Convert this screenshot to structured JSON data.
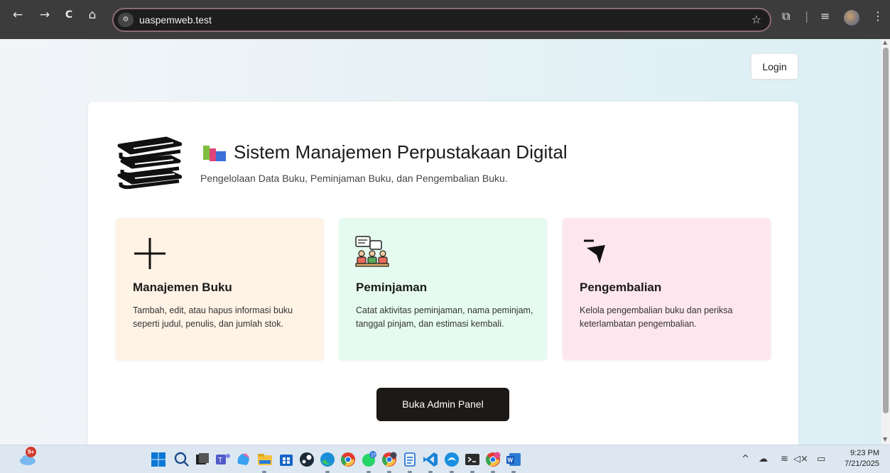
{
  "browser": {
    "url": "uaspemweb.test",
    "back_icon": "←",
    "forward_icon": "→",
    "reload_icon": "C",
    "home_icon": "⌂",
    "site_info_icon": "⚙",
    "star_icon": "☆",
    "extensions_icon": "⧉",
    "separator": "|",
    "reading_list_icon": "≡",
    "menu_icon": "⋮"
  },
  "header": {
    "login_label": "Login"
  },
  "hero": {
    "title": "Sistem Manajemen Perpustakaan Digital",
    "subtitle": "Pengelolaan Data Buku, Peminjaman Buku, dan Pengembalian Buku."
  },
  "features": [
    {
      "title": "Manajemen Buku",
      "description": "Tambah, edit, atau hapus informasi buku seperti judul, penulis, dan jumlah stok.",
      "icon": "plus-icon",
      "bg": "#fff3e6"
    },
    {
      "title": "Peminjaman",
      "description": "Catat aktivitas peminjaman, nama peminjam, tanggal pinjam, dan estimasi kembali.",
      "icon": "discussion-icon",
      "bg": "#e5fbef"
    },
    {
      "title": "Pengembalian",
      "description": "Kelola pengembalian buku dan periksa keterlambatan pengembalian.",
      "icon": "return-arrow-icon",
      "bg": "#fee6ee"
    }
  ],
  "cta": {
    "admin_label": "Buka Admin Panel"
  },
  "taskbar": {
    "weather_badge": "9+",
    "tray_chevron": "^",
    "tray_cloud": "☁",
    "tray_wifi": "≋",
    "tray_volume": "◁×",
    "tray_battery": "▭",
    "time": "9:23 PM",
    "date": "7/21/2025"
  }
}
